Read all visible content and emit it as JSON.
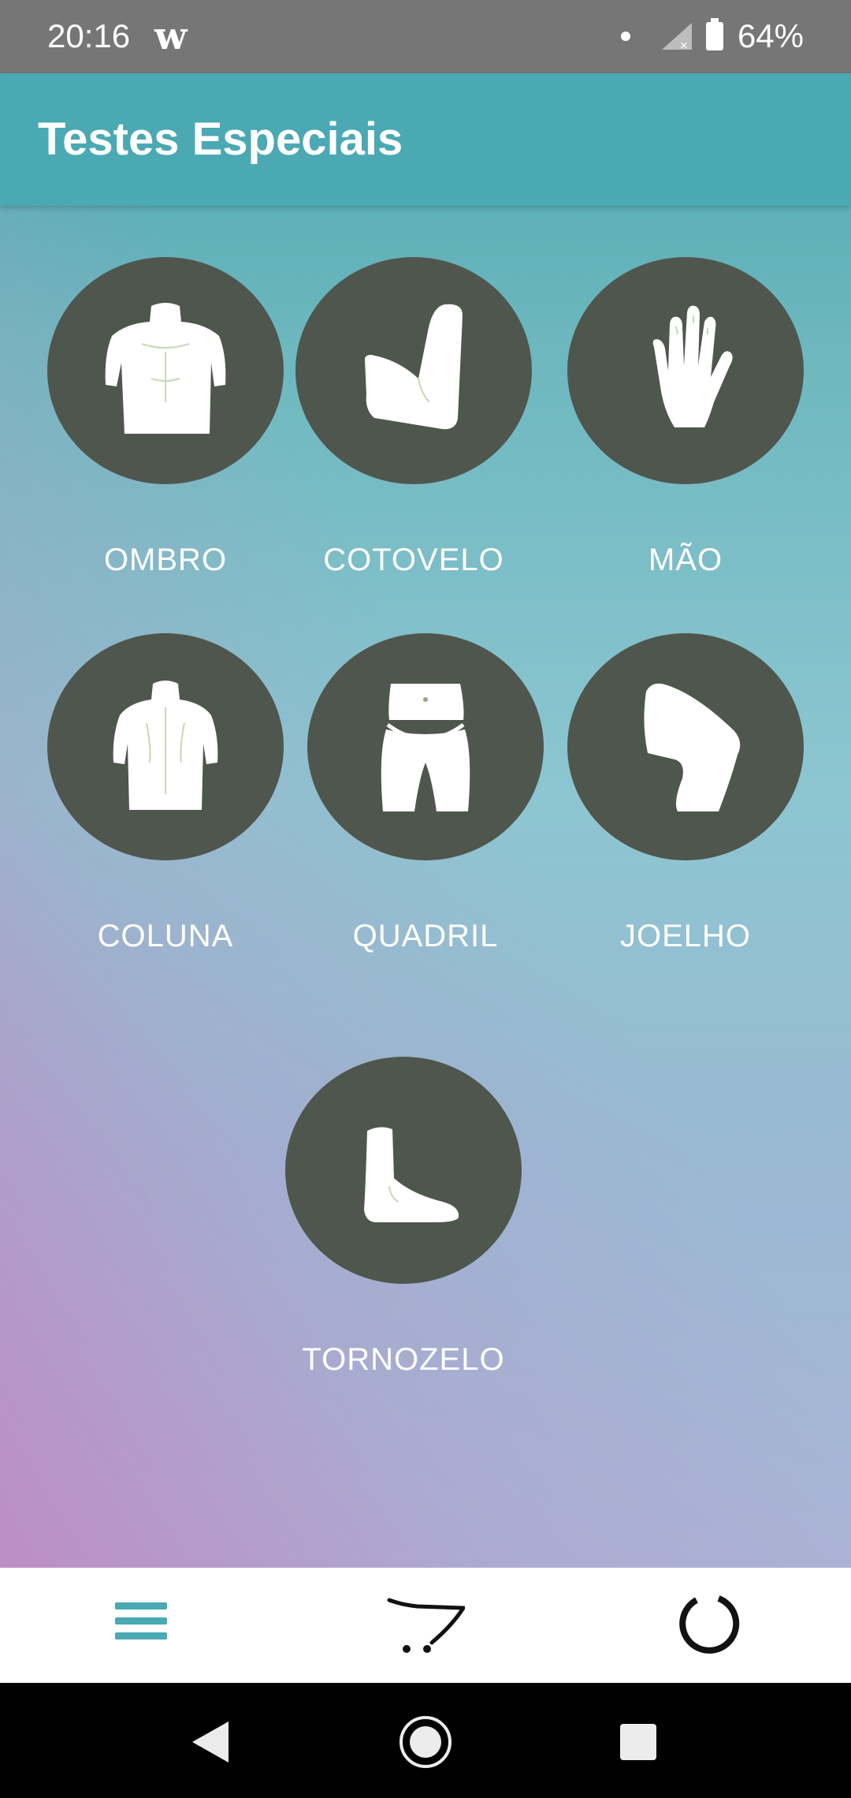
{
  "status_bar": {
    "time": "20:16",
    "app_glyph": "w",
    "battery": "64%"
  },
  "header": {
    "title": "Testes Especiais"
  },
  "body_parts": [
    {
      "label": "OMBRO",
      "icon": "torso-front-icon"
    },
    {
      "label": "COTOVELO",
      "icon": "elbow-icon"
    },
    {
      "label": "MÃO",
      "icon": "hand-icon"
    },
    {
      "label": "COLUNA",
      "icon": "back-icon"
    },
    {
      "label": "QUADRIL",
      "icon": "hip-icon"
    },
    {
      "label": "JOELHO",
      "icon": "knee-icon"
    },
    {
      "label": "TORNOZELO",
      "icon": "foot-icon"
    }
  ],
  "bottom_nav": {
    "items": [
      "menu-icon",
      "cart-icon",
      "circle-icon"
    ]
  },
  "colors": {
    "accent": "#4aa9b3",
    "circle": "#4f564d"
  }
}
